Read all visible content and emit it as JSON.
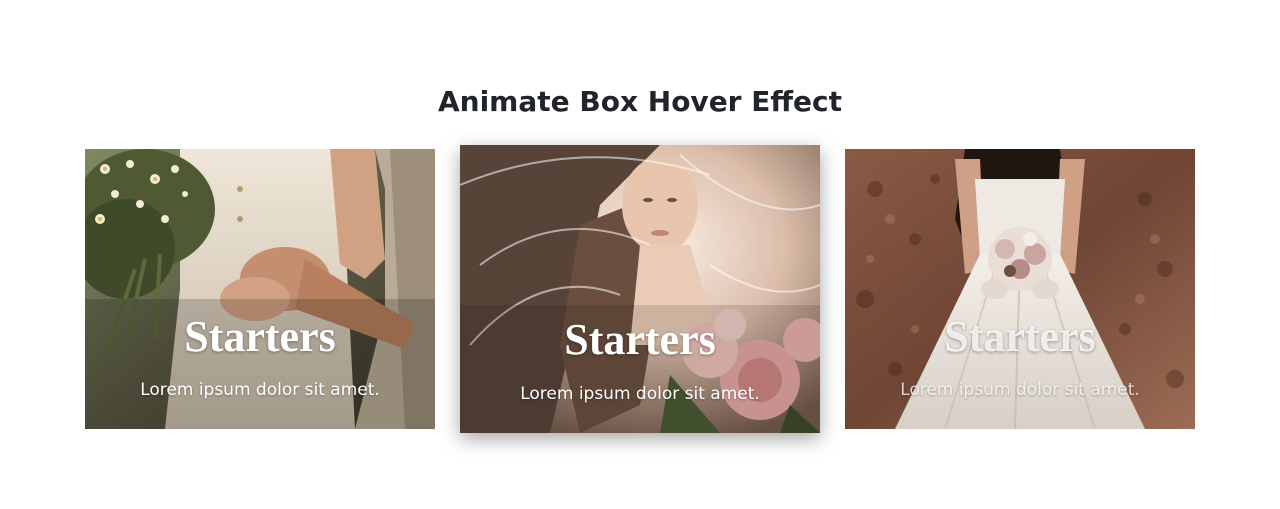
{
  "heading": "Animate Box Hover Effect",
  "cards": [
    {
      "title": "Starters",
      "text": "Lorem ipsum dolor sit amet.",
      "image": "couple-holding-hands-with-wildflower-bouquet"
    },
    {
      "title": "Starters",
      "text": "Lorem ipsum dolor sit amet.",
      "image": "bride-in-veil-with-pink-roses",
      "state": "hovered"
    },
    {
      "title": "Starters",
      "text": "Lorem ipsum dolor sit amet.",
      "image": "bride-in-white-gown-holding-bouquet"
    }
  ],
  "colors": {
    "heading": "#212529",
    "card_text": "#ffffff",
    "background": "#ffffff"
  }
}
